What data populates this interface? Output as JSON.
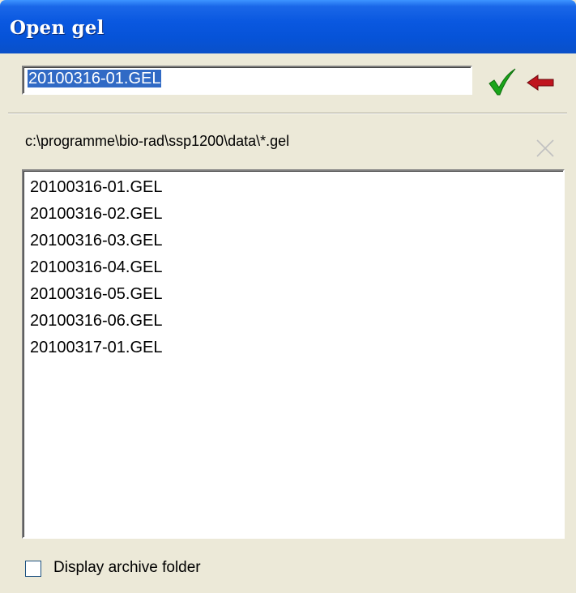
{
  "window": {
    "title": "Open gel"
  },
  "filename": {
    "value": "20100316-01.GEL"
  },
  "icons": {
    "confirm": "checkmark-icon",
    "back": "back-arrow-icon",
    "cancel": "close-icon"
  },
  "colors": {
    "titlebar": "#0a58e0",
    "confirm_green": "#1aa51a",
    "back_red": "#c0141e",
    "selection": "#316ac5"
  },
  "path": {
    "label": "c:\\programme\\bio-rad\\ssp1200\\data\\*.gel"
  },
  "files": [
    {
      "name": "20100316-01.GEL"
    },
    {
      "name": "20100316-02.GEL"
    },
    {
      "name": "20100316-03.GEL"
    },
    {
      "name": "20100316-04.GEL"
    },
    {
      "name": "20100316-05.GEL"
    },
    {
      "name": "20100316-06.GEL"
    },
    {
      "name": "20100317-01.GEL"
    }
  ],
  "archive_option": {
    "label": "Display archive folder",
    "checked": false
  }
}
